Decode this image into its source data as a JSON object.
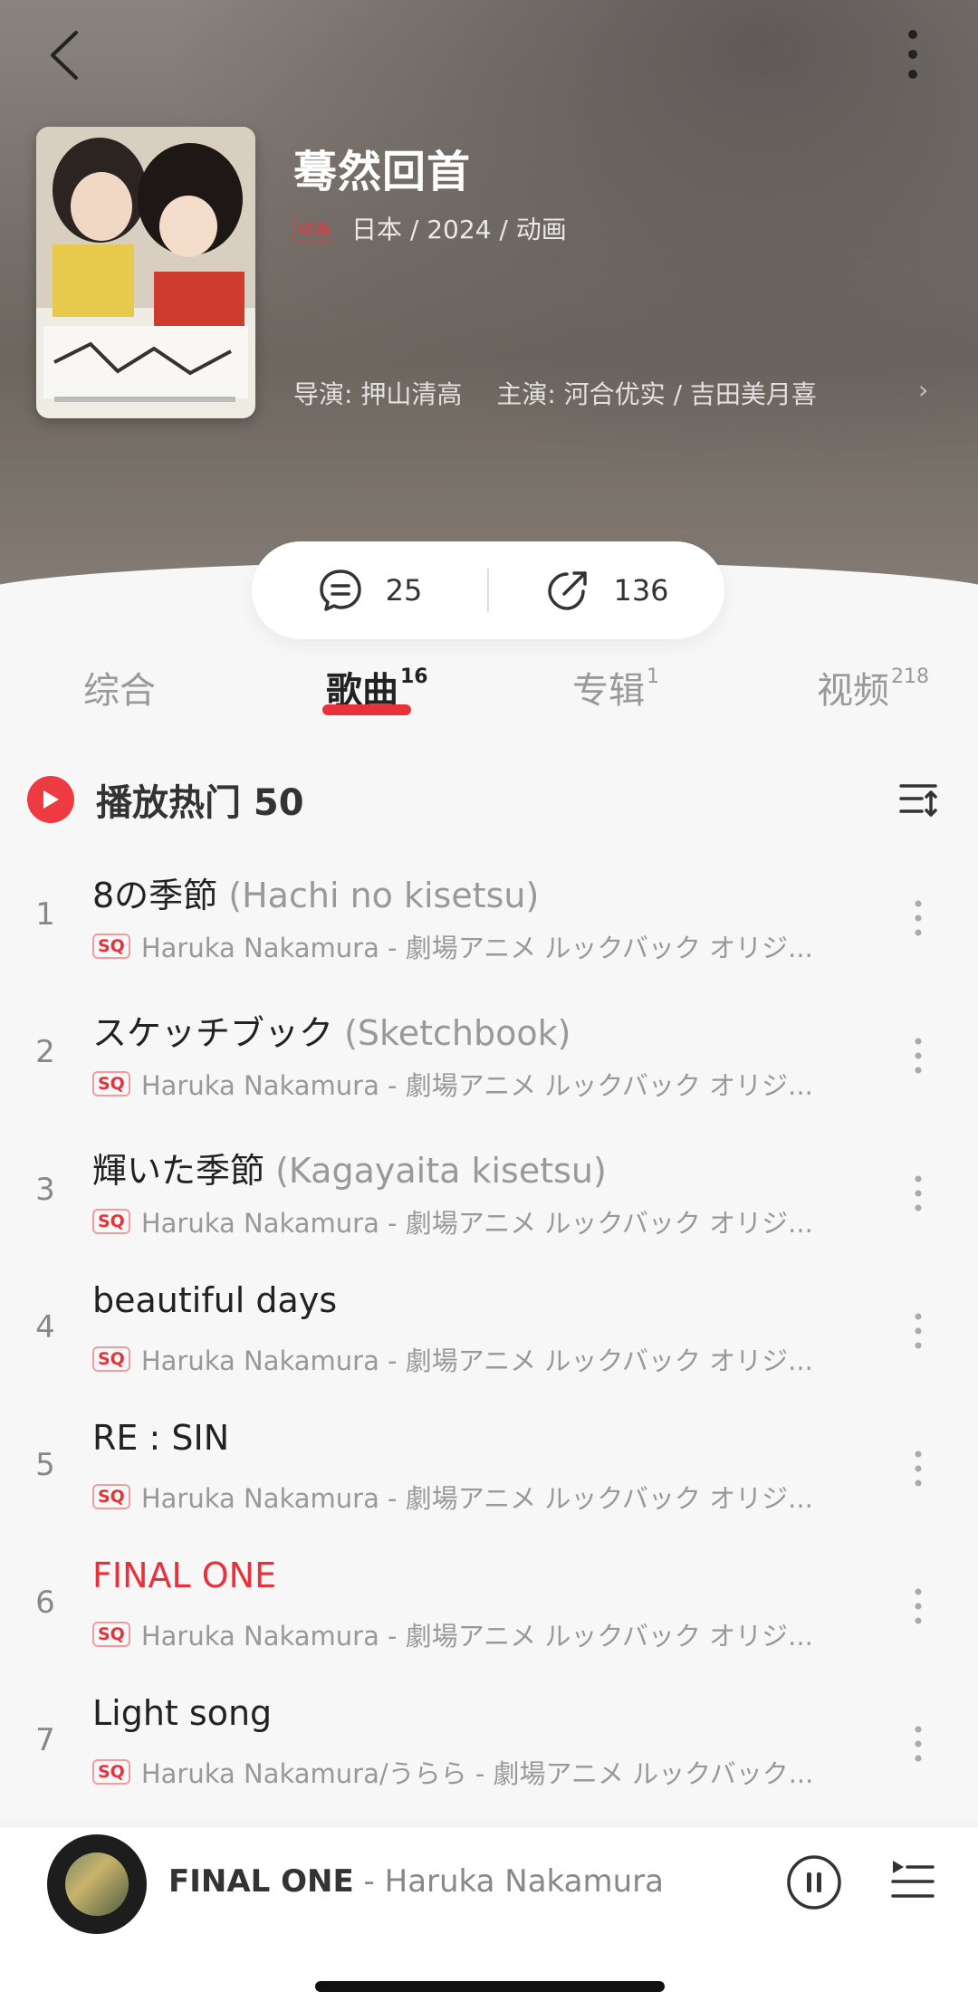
{
  "header": {
    "title": "蓦然回首",
    "badge": "动画",
    "meta": "日本 / 2024 / 动画",
    "director": "导演: 押山清高",
    "cast": "主演: 河合优实 / 吉田美月喜",
    "icons": {
      "back": "back-arrow-icon",
      "more": "more-vertical-icon"
    }
  },
  "stats": {
    "comments": "25",
    "shares": "136"
  },
  "tabs": [
    {
      "label": "综合",
      "count": ""
    },
    {
      "label": "歌曲",
      "count": "16"
    },
    {
      "label": "专辑",
      "count": "1"
    },
    {
      "label": "视频",
      "count": "218"
    }
  ],
  "playall": {
    "label": "播放热门 50"
  },
  "songs": [
    {
      "num": "1",
      "title": "8の季節",
      "subtitle": "(Hachi no kisetsu)",
      "quality": "SQ",
      "artist": "Haruka Nakamura - 劇場アニメ ルックバック オリジ..."
    },
    {
      "num": "2",
      "title": "スケッチブック",
      "subtitle": "(Sketchbook)",
      "quality": "SQ",
      "artist": "Haruka Nakamura - 劇場アニメ ルックバック オリジ..."
    },
    {
      "num": "3",
      "title": "輝いた季節",
      "subtitle": "(Kagayaita kisetsu)",
      "quality": "SQ",
      "artist": "Haruka Nakamura - 劇場アニメ ルックバック オリジ..."
    },
    {
      "num": "4",
      "title": "beautiful days",
      "subtitle": "",
      "quality": "SQ",
      "artist": "Haruka Nakamura - 劇場アニメ ルックバック オリジ..."
    },
    {
      "num": "5",
      "title": "RE : SIN",
      "subtitle": "",
      "quality": "SQ",
      "artist": "Haruka Nakamura - 劇場アニメ ルックバック オリジ..."
    },
    {
      "num": "6",
      "title": "FINAL ONE",
      "subtitle": "",
      "quality": "SQ",
      "artist": "Haruka Nakamura - 劇場アニメ ルックバック オリジ..."
    },
    {
      "num": "7",
      "title": "Light song",
      "subtitle": "",
      "quality": "SQ",
      "artist": "Haruka Nakamura/うらら - 劇場アニメ ルックバック..."
    }
  ],
  "player": {
    "title": "FINAL ONE",
    "separator": " - ",
    "artist": "Haruka Nakamura"
  },
  "colors": {
    "accent": "#e7313b",
    "text": "#222222",
    "muted": "#999999"
  }
}
